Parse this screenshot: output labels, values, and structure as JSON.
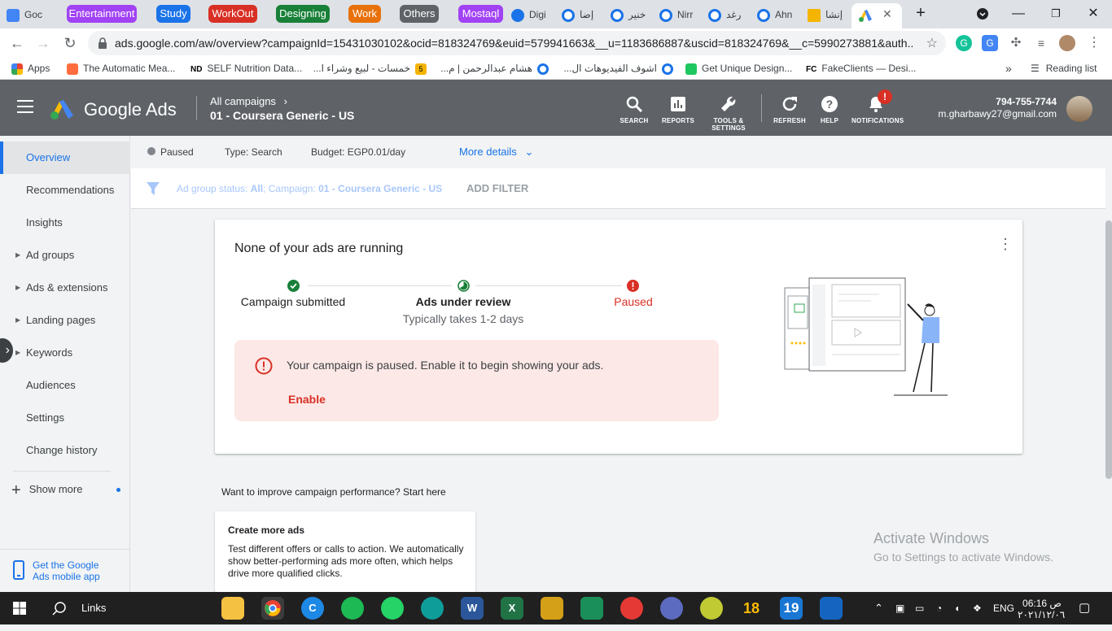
{
  "browser": {
    "tab_groups": [
      {
        "label": "Entertainment",
        "color": "#a142f4"
      },
      {
        "label": "Study",
        "color": "#1a73e8"
      },
      {
        "label": "WorkOut",
        "color": "#d93025"
      },
      {
        "label": "Designing",
        "color": "#188038"
      },
      {
        "label": "Work",
        "color": "#e8710a"
      },
      {
        "label": "Others",
        "color": "#5f6368"
      },
      {
        "label": "Mostaql",
        "color": "#a142f4"
      }
    ],
    "tabs": [
      "Goc",
      "Digi",
      "إضا",
      "خنير",
      "Nirr",
      "رغد",
      "Ahn",
      "إنشا"
    ],
    "url": "ads.google.com/aw/overview?campaignId=15431030102&ocid=818324769&euid=579941663&__u=1183686887&uscid=818324769&__c=5990273881&auth...",
    "bookmarks": [
      "Apps",
      "The Automatic Mea...",
      "SELF Nutrition Data...",
      "خمسات - لبيع وشراء ا...",
      "هشام عبدالرحمن | م...",
      "اشوف الفيديوهات ال...",
      "Get Unique Design...",
      "FakeClients — Desi..."
    ],
    "bookmark_badges": [
      "ND",
      "5",
      "FC"
    ],
    "more_bookmarks": "»",
    "reading_list": "Reading list"
  },
  "ads_header": {
    "product": "Google Ads",
    "breadcrumb_parent": "All campaigns",
    "campaign": "01 - Coursera Generic - US",
    "tools": [
      "SEARCH",
      "REPORTS",
      "TOOLS & SETTINGS",
      "REFRESH",
      "HELP",
      "NOTIFICATIONS"
    ],
    "notification_badge": "!",
    "account_phone": "794-755-7744",
    "account_email": "m.gharbawy27@gmail.com"
  },
  "nav": {
    "items": [
      "Overview",
      "Recommendations",
      "Insights",
      "Ad groups",
      "Ads & extensions",
      "Landing pages",
      "Keywords",
      "Audiences",
      "Settings",
      "Change history"
    ],
    "show_more": "Show more",
    "mobile_app": "Get the Google Ads mobile app"
  },
  "summary": {
    "status": "Paused",
    "type": "Type: Search",
    "budget": "Budget: EGP0.01/day",
    "more_details": "More details"
  },
  "filter": {
    "prefix": "Ad group status: ",
    "status_value": "All",
    "campaign_prefix": "; Campaign: ",
    "campaign_value": "01 - Coursera Generic - US",
    "add_filter": "ADD FILTER"
  },
  "status_card": {
    "title": "None of your ads are running",
    "steps": [
      {
        "label": "Campaign submitted",
        "sub": ""
      },
      {
        "label": "Ads under review",
        "sub": "Typically takes 1-2 days"
      },
      {
        "label": "Paused",
        "sub": ""
      }
    ],
    "alert": "Your campaign is paused. Enable it to begin showing your ads.",
    "enable": "Enable"
  },
  "improve": {
    "heading": "Want to improve campaign performance? Start here",
    "card_title": "Create more ads",
    "card_body": "Test different offers or calls to action. We automatically show better-performing ads more often, which helps drive more qualified clicks."
  },
  "watermark": {
    "line1": "Activate Windows",
    "line2": "Go to Settings to activate Windows."
  },
  "taskbar": {
    "search": "Links",
    "apps": [
      "18",
      "19"
    ],
    "lang": "ENG",
    "time": "06:16 ص",
    "date": "٢٠٢١/١٢/٠٦"
  }
}
